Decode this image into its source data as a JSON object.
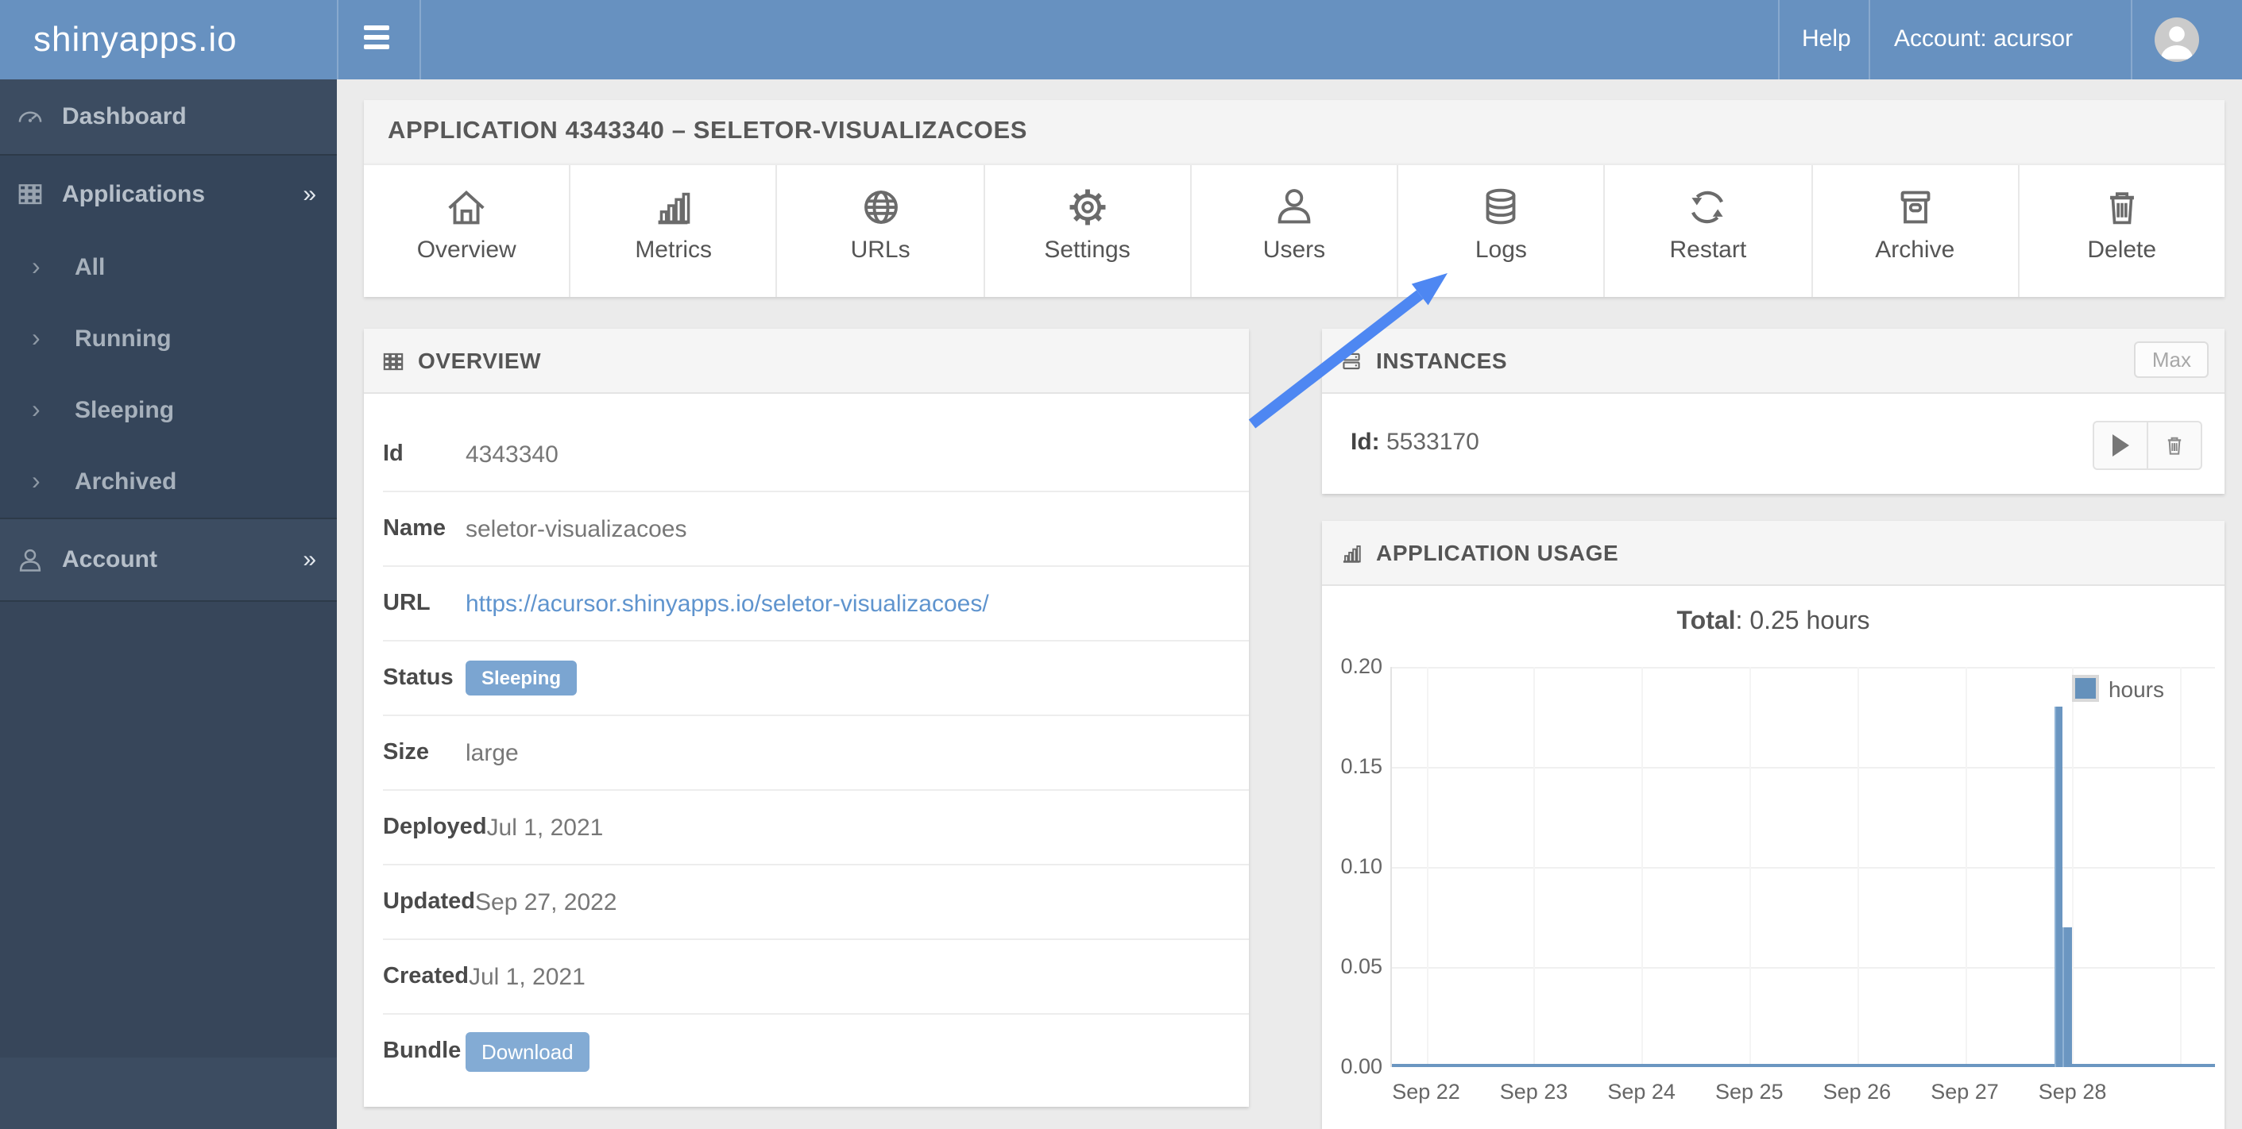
{
  "navbar": {
    "logo": "shinyapps.io",
    "help_label": "Help",
    "account_label": "Account:  acursor"
  },
  "sidebar": {
    "sections": [
      {
        "type": "item",
        "icon": "gauge-icon",
        "label": "Dashboard"
      },
      {
        "type": "group",
        "icon": "grid-icon",
        "label": "Applications",
        "chevron": "»",
        "expanded": true,
        "children": [
          {
            "label": "All"
          },
          {
            "label": "Running"
          },
          {
            "label": "Sleeping"
          },
          {
            "label": "Archived"
          }
        ]
      },
      {
        "type": "item",
        "icon": "person-icon",
        "label": "Account",
        "chevron": "»"
      }
    ]
  },
  "page": {
    "title": "APPLICATION 4343340 – SELETOR-VISUALIZACOES"
  },
  "toolbar": {
    "items": [
      {
        "icon": "house-icon",
        "label": "Overview"
      },
      {
        "icon": "bar-chart-icon",
        "label": "Metrics"
      },
      {
        "icon": "globe-icon",
        "label": "URLs"
      },
      {
        "icon": "gear-icon",
        "label": "Settings"
      },
      {
        "icon": "user-icon",
        "label": "Users"
      },
      {
        "icon": "database-icon",
        "label": "Logs"
      },
      {
        "icon": "restart-icon",
        "label": "Restart"
      },
      {
        "icon": "archive-icon",
        "label": "Archive"
      },
      {
        "icon": "trash-icon",
        "label": "Delete"
      }
    ]
  },
  "overview": {
    "title": "OVERVIEW",
    "icon": "grid-icon",
    "rows": [
      {
        "label": "Id",
        "value": "4343340",
        "kind": "text"
      },
      {
        "label": "Name",
        "value": "seletor-visualizacoes",
        "kind": "text"
      },
      {
        "label": "URL",
        "value": "https://acursor.shinyapps.io/seletor-visualizacoes/",
        "kind": "link"
      },
      {
        "label": "Status",
        "value": "Sleeping",
        "kind": "badge"
      },
      {
        "label": "Size",
        "value": "large",
        "kind": "text"
      },
      {
        "label": "Deployed",
        "value": "Jul 1, 2021",
        "kind": "text"
      },
      {
        "label": "Updated",
        "value": "Sep 27, 2022",
        "kind": "text"
      },
      {
        "label": "Created",
        "value": "Jul 1, 2021",
        "kind": "text"
      },
      {
        "label": "Bundle",
        "value": "Download",
        "kind": "button"
      }
    ]
  },
  "instances": {
    "title": "INSTANCES",
    "icon": "server-icon",
    "max_label": "Max",
    "id_label": "Id:",
    "id_value": "5533170"
  },
  "usage": {
    "title": "APPLICATION USAGE",
    "icon": "bar-chart-icon",
    "total_label": "Total",
    "total_rest": ": 0.25 hours"
  },
  "chart_data": {
    "type": "bar",
    "title": "Total: 0.25 hours",
    "xlabel": "",
    "ylabel": "",
    "ylim": [
      0,
      0.2
    ],
    "y_ticks": [
      {
        "value": 0.0,
        "label": "0.00"
      },
      {
        "value": 0.05,
        "label": "0.05"
      },
      {
        "value": 0.1,
        "label": "0.10"
      },
      {
        "value": 0.15,
        "label": "0.15"
      },
      {
        "value": 0.2,
        "label": "0.20"
      }
    ],
    "x_ticks": [
      "Sep 22",
      "Sep 23",
      "Sep 24",
      "Sep 25",
      "Sep 26",
      "Sep 27",
      "Sep 28"
    ],
    "grid": true,
    "legend": {
      "position": "top-right",
      "entries": [
        {
          "label": "hours",
          "color": "#6591bb"
        }
      ]
    },
    "series": [
      {
        "name": "hours",
        "baseline_value": 0.002,
        "baseline_note": "near-zero hourly usage bars across entire date range",
        "bars": [
          {
            "x_days_after_sep22": 5.86,
            "value": 0.18
          },
          {
            "x_days_after_sep22": 5.94,
            "value": 0.07
          }
        ]
      }
    ]
  },
  "annotation": {
    "arrow_color": "#4e87f2",
    "arrow_target": "Logs toolbar item"
  },
  "colors": {
    "navbar_bg": "#6791c0",
    "sidebar_bg": "#3c4c61",
    "sidebar_section_bg": "#35455a",
    "page_bg": "#ebebeb",
    "bar_blue": "#6b96c1",
    "badge_blue": "#7ba5d1",
    "link_blue": "#5f94ce",
    "arrow_blue": "#4e87f2"
  }
}
